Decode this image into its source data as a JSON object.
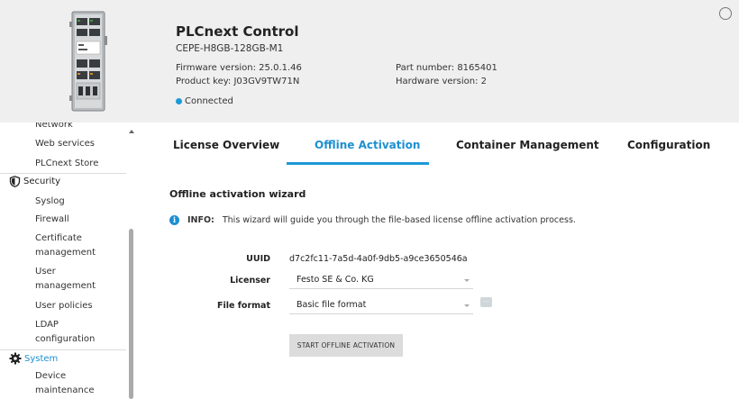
{
  "header": {
    "title": "PLCnext Control",
    "model": "CEPE-H8GB-128GB-M1",
    "firmware_version": "Firmware version: 25.0.1.46",
    "product_key": "Product key: J03GV9TW71N",
    "part_number": "Part number: 8165401",
    "hardware_version": "Hardware version: 2",
    "status": "Connected",
    "status_color": "#1d9ad6"
  },
  "sidebar": {
    "items": [
      {
        "label": "Network"
      },
      {
        "label": "Web services"
      },
      {
        "label": "PLCnext Store"
      },
      {
        "label": "Security",
        "section": true,
        "icon": "shield-icon"
      },
      {
        "label": "Syslog"
      },
      {
        "label": "Firewall"
      },
      {
        "label": "Certificate management"
      },
      {
        "label": "User management"
      },
      {
        "label": "User policies"
      },
      {
        "label": "LDAP configuration"
      },
      {
        "label": "System",
        "section": true,
        "icon": "gear-icon",
        "active": true
      },
      {
        "label": "Device maintenance"
      }
    ]
  },
  "tabs": [
    {
      "label": "License Overview",
      "active": false
    },
    {
      "label": "Offline Activation",
      "active": true
    },
    {
      "label": "Container Management",
      "active": false
    },
    {
      "label": "Configuration",
      "active": false
    }
  ],
  "main": {
    "wizard_title": "Offline activation wizard",
    "info_label": "INFO:",
    "info_text": "This wizard will guide you through the file-based license offline activation process.",
    "uuid_label": "UUID",
    "uuid_value": "d7c2fc11-7a5d-4a0f-9db5-a9ce3650546a",
    "licenser_label": "Licenser",
    "licenser_value": "Festo SE & Co. KG",
    "file_format_label": "File format",
    "file_format_value": "Basic file format",
    "start_button": "START OFFLINE ACTIVATION"
  },
  "colors": {
    "accent": "#1d8fd0",
    "header_bg": "#efefef"
  }
}
